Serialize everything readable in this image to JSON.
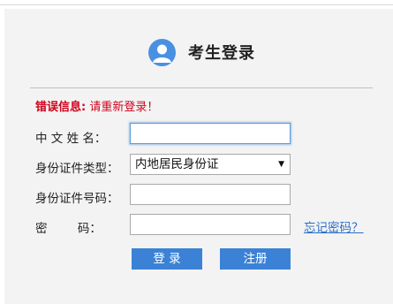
{
  "header": {
    "title": "考生登录",
    "avatar_icon": "user-avatar-icon",
    "accent_color": "#4a90e2"
  },
  "error": {
    "label": "错误信息:",
    "message": " 请重新登录！",
    "color": "#d0021b"
  },
  "form": {
    "name_label": "中 文 姓 名：",
    "id_type_label": "身份证件类型：",
    "id_type_value": "内地居民身份证",
    "id_number_label": "身份证件号码：",
    "password_label": "密        码：",
    "forgot_link": "忘记密码？"
  },
  "buttons": {
    "login": "登 录",
    "register": "注册",
    "color": "#3b82d6"
  }
}
